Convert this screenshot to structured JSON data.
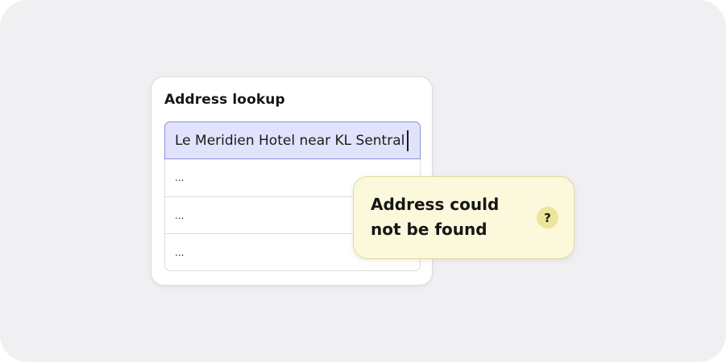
{
  "lookup": {
    "title": "Address lookup",
    "search_value": "Le Meridien Hotel near KL Sentral",
    "results": [
      "...",
      "...",
      "..."
    ]
  },
  "tooltip": {
    "message_line1": "Address could",
    "message_line2": "not be found",
    "help_glyph": "?",
    "icon": "help-icon"
  },
  "colors": {
    "background": "#f0f0f2",
    "input_highlight": "#e1e2fc",
    "input_border": "#8c90dc",
    "tooltip_background": "#fbf8dc",
    "help_icon_background": "#ece59a"
  }
}
